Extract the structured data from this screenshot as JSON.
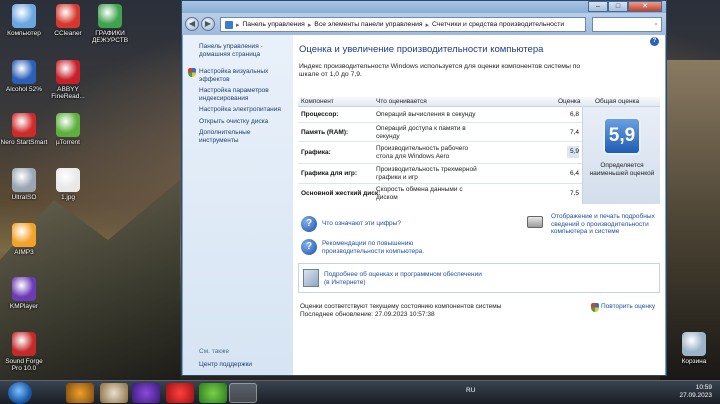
{
  "desktop_icons": [
    {
      "label": "Компьютер",
      "color": "#6aa7e0"
    },
    {
      "label": "CCleaner",
      "color": "#d6382c"
    },
    {
      "label": "ГРАФИКИ ДЕЖУРСТВ",
      "color": "#3fa34d"
    },
    {
      "label": "Alcohol 52%",
      "color": "#2c5fb8"
    },
    {
      "label": "ABBYY FineRead...",
      "color": "#c8202a"
    },
    {
      "label": "Nero StartSmart",
      "color": "#d02a2a"
    },
    {
      "label": "µTorrent",
      "color": "#5bb13b"
    },
    {
      "label": "UltraISO",
      "color": "#9aa6b3"
    },
    {
      "label": "1.jpg",
      "color": "#e8e8e8"
    },
    {
      "label": "AIMP3",
      "color": "#f2a22a"
    },
    {
      "label": "KMPlayer",
      "color": "#6c3bb8"
    },
    {
      "label": "Sound Forge Pro 10.0",
      "color": "#c52a2a"
    },
    {
      "label": "Корзина",
      "color": "#9cb3c8"
    }
  ],
  "window": {
    "breadcrumb": [
      "Панель управления",
      "Все элементы панели управления",
      "Счетчики и средства производительности"
    ]
  },
  "left_pane": {
    "home_link": "Панель управления - домашняя страница",
    "tasks": [
      {
        "label": "Настройка визуальных эффектов",
        "icon": "shield-icon"
      },
      {
        "label": "Настройка параметров индексирования",
        "icon": ""
      },
      {
        "label": "Настройка электропитания",
        "icon": ""
      },
      {
        "label": "Открыть очистку диска",
        "icon": ""
      },
      {
        "label": "Дополнительные инструменты",
        "icon": ""
      }
    ],
    "see_also": "См. также",
    "support_link": "Центр поддержки"
  },
  "main": {
    "heading": "Оценка и увеличение производительности компьютера",
    "intro": "Индекс производительности Windows используется для оценки компонентов системы по шкале от 1,0 до 7,9.",
    "table_headers": {
      "component": "Компонент",
      "what": "Что оценивается",
      "score": "Оценка",
      "overall": "Общая оценка"
    },
    "rows": [
      {
        "component": "Процессор:",
        "what": "Операций вычисления в секунду",
        "score": "6,8"
      },
      {
        "component": "Память (RAM):",
        "what": "Операций доступа к памяти в секунду",
        "score": "7,4"
      },
      {
        "component": "Графика:",
        "what": "Производительность рабочего стола для Windows Aero",
        "score": "5,9"
      },
      {
        "component": "Графика для игр:",
        "what": "Производительность трехмерной графики и игр",
        "score": "6,4"
      },
      {
        "component": "Основной жесткий диск:",
        "what": "Скорость обмена данными с диском",
        "score": "7,5"
      }
    ],
    "overall_score": "5,9",
    "overall_caption": "Определяется наименьшей оценкой",
    "link_numbers": "Что означают эти цифры?",
    "link_print": "Отображение и печать подробных сведений о производительности компьютера и системе",
    "link_tips": "Рекомендации по повышению производительности компьютера.",
    "link_online": "Подробнее об оценках и программном обеспечении (в Интернете)",
    "status": "Оценки соответствуют текущему состоянию компонентов системы",
    "last_update": "Последнее обновление: 27.09.2023 10:57:38",
    "rerun": "Повторить оценку"
  },
  "taskbar": {
    "lang": "RU",
    "time": "10:59",
    "date": "27.09.2023"
  }
}
